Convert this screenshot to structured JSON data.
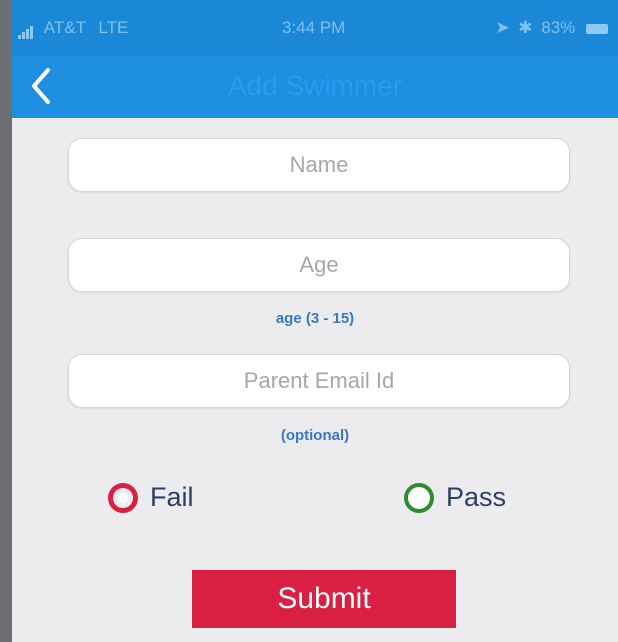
{
  "status_bar": {
    "carrier": "AT&T",
    "network": "LTE",
    "time": "3:44 PM",
    "battery": "83%"
  },
  "nav": {
    "title": "Add Swimmer",
    "back_icon": "chevron-left-icon"
  },
  "form": {
    "name": {
      "placeholder": "Name",
      "value": ""
    },
    "age": {
      "placeholder": "Age",
      "value": "",
      "hint": "age (3 - 15)"
    },
    "email": {
      "placeholder": "Parent Email Id",
      "value": "",
      "hint": "(optional)"
    },
    "result": {
      "options": [
        {
          "label": "Fail",
          "selected": true
        },
        {
          "label": "Pass",
          "selected": false
        }
      ]
    },
    "submit_label": "Submit"
  },
  "colors": {
    "nav_blue": "#1e8ee0",
    "fail_red": "#d91f42",
    "pass_green": "#2e8b2e",
    "hint_blue": "#3a78c0",
    "submit_red": "#d91f42"
  }
}
